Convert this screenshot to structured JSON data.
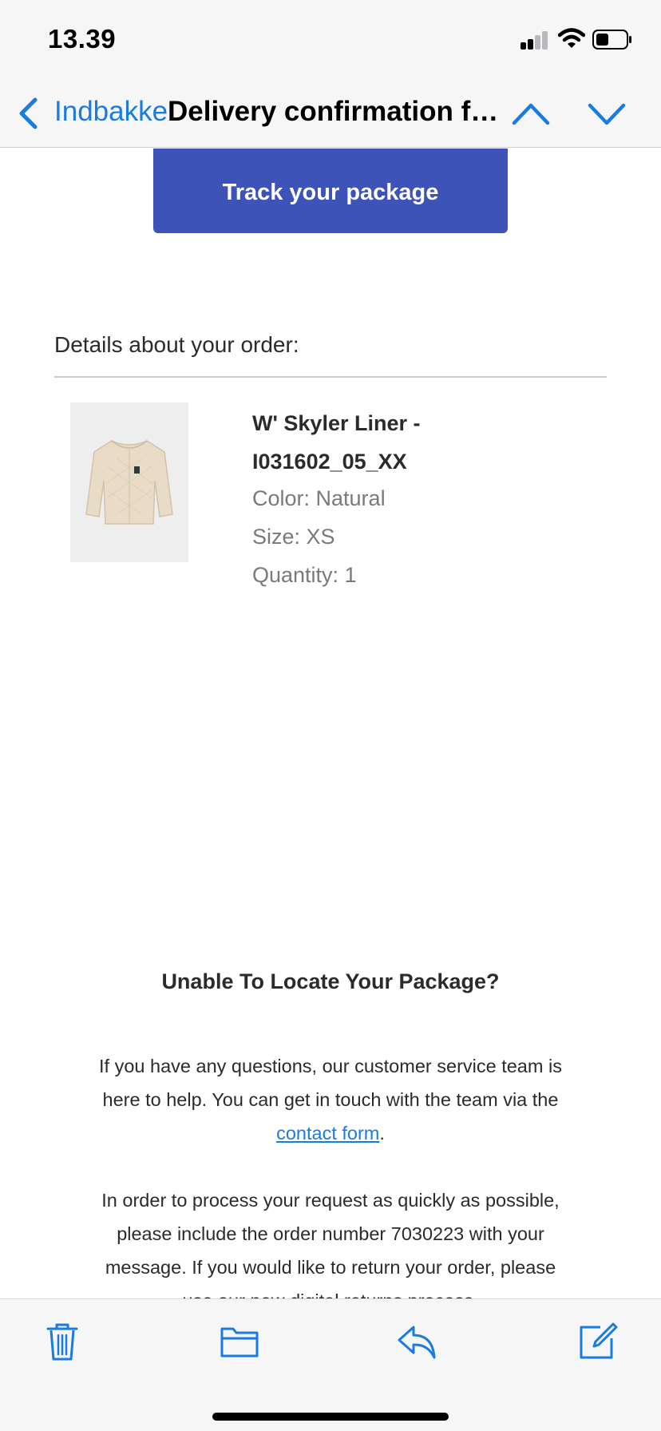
{
  "status_bar": {
    "time": "13.39",
    "icons": [
      "signal-icon",
      "wifi-icon",
      "battery-icon"
    ]
  },
  "nav": {
    "back_label": "Indbakke",
    "title": "Delivery confirmation fo...",
    "icons": [
      "chevron-left-icon",
      "chevron-up-icon",
      "chevron-down-icon"
    ]
  },
  "email": {
    "track_button": "Track your package",
    "details_heading": "Details about your order:",
    "product": {
      "name_line1": "W' Skyler Liner -",
      "name_line2": "I031602_05_XX",
      "color": "Color: Natural",
      "size": "Size: XS",
      "quantity": "Quantity: 1"
    },
    "unable_heading": "Unable To Locate Your Package?",
    "help": {
      "text_before": "If you have any questions, our customer service team is here to help. You can get in touch with the team via the ",
      "link": "contact form",
      "text_after": "."
    },
    "process_text": "In order to process your request as quickly as possible, please include the order number 7030223 with your message. If you would like to return your order, please use our new digital returns process."
  },
  "toolbar": {
    "icons": [
      "trash-icon",
      "folder-icon",
      "reply-icon",
      "compose-icon"
    ]
  },
  "colors": {
    "accent": "#1a7be0",
    "button": "#3d53b8",
    "bar_background": "#f6f6f7"
  }
}
